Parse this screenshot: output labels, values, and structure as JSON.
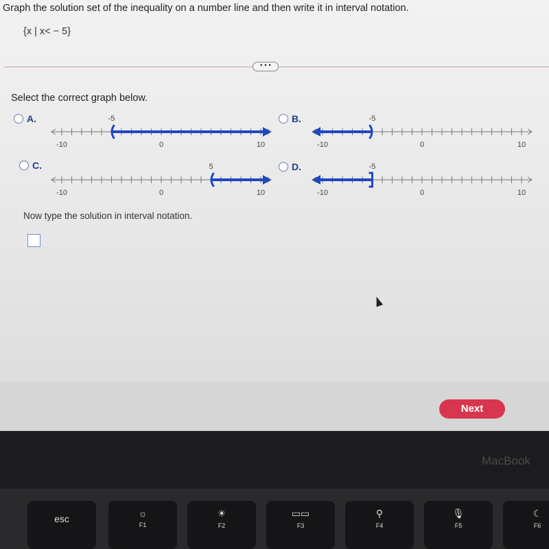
{
  "question": "Graph the solution set of the inequality on a number line and then write it in interval notation.",
  "set_notation": "{x | x< − 5}",
  "more_label": "• • •",
  "prompt": "Select the correct graph below.",
  "options": [
    {
      "letter": "A.",
      "endpoint": -5,
      "endpoint_label": "-5",
      "mark": "(",
      "direction": "right",
      "ticks": {
        "left": "-10",
        "mid": "0",
        "right": "10"
      }
    },
    {
      "letter": "B.",
      "endpoint": -5,
      "endpoint_label": "-5",
      "mark": ")",
      "direction": "left",
      "ticks": {
        "left": "-10",
        "mid": "0",
        "right": "10"
      }
    },
    {
      "letter": "C.",
      "endpoint": 5,
      "endpoint_label": "5",
      "mark": "(",
      "direction": "right",
      "ticks": {
        "left": "-10",
        "mid": "0",
        "right": "10"
      }
    },
    {
      "letter": "D.",
      "endpoint": -5,
      "endpoint_label": "-5",
      "mark": "]",
      "direction": "left",
      "ticks": {
        "left": "-10",
        "mid": "0",
        "right": "10"
      }
    }
  ],
  "type_prompt": "Now type the solution in interval notation.",
  "answer_value": "",
  "next_label": "Next",
  "colors": {
    "accent": "#1f47c4",
    "next": "#d8364f"
  },
  "brand": "MacBook",
  "keyboard": [
    {
      "label": "esc",
      "icon": ""
    },
    {
      "label": "F1",
      "icon": "☼"
    },
    {
      "label": "F2",
      "icon": "☀"
    },
    {
      "label": "F3",
      "icon": "▭▭"
    },
    {
      "label": "F4",
      "icon": "⚲"
    },
    {
      "label": "F5",
      "icon": "🎙"
    },
    {
      "label": "F6",
      "icon": "☾"
    }
  ]
}
